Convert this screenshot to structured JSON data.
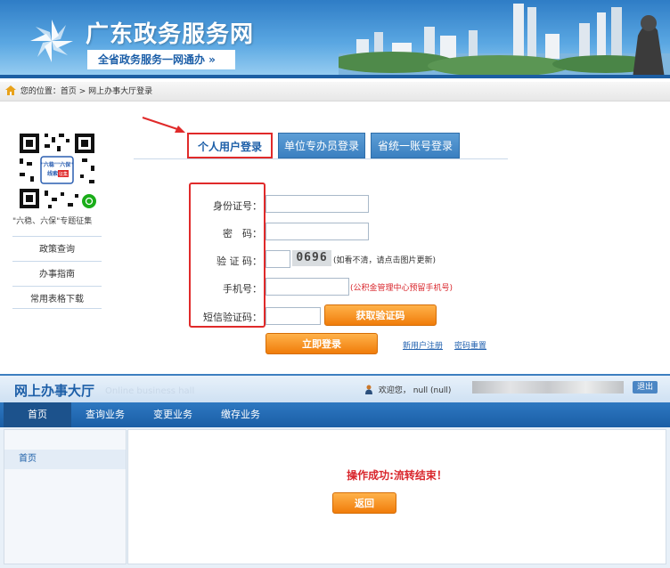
{
  "banner": {
    "site_title": "广东政务服务网",
    "slogan": "全省政务服务一网通办 »"
  },
  "breadcrumb": {
    "prefix": "您的位置：",
    "home": "首页",
    "separator": " > ",
    "current": "网上办事大厅登录"
  },
  "sidebar": {
    "qr_caption": "\"六稳、六保\"专题征集",
    "qr_badge": [
      "\"六稳\"\"六保\"",
      "线索",
      "征集"
    ],
    "links": [
      "政策查询",
      "办事指南",
      "常用表格下载"
    ]
  },
  "tabs": [
    {
      "label": "个人用户登录",
      "active": true
    },
    {
      "label": "单位专办员登录",
      "active": false
    },
    {
      "label": "省统一账号登录",
      "active": false
    }
  ],
  "form": {
    "id_label": "身份证号：",
    "password_label": "密　码：",
    "captcha_label": "验 证 码：",
    "captcha_value": "0696",
    "captcha_hint": "(如看不清，请点击图片更新)",
    "phone_label": "手机号：",
    "phone_hint": "(公积金管理中心预留手机号)",
    "sms_label": "短信验证码：",
    "get_code_button": "获取验证码",
    "login_button": "立即登录",
    "register_link": "新用户注册",
    "reset_link": "密码重置"
  },
  "hall": {
    "title": "网上办事大厅",
    "subtitle": "Online business hall",
    "welcome": "欢迎您， null (null)",
    "logout": "退出",
    "nav": [
      {
        "label": "首页",
        "active": true
      },
      {
        "label": "查询业务",
        "active": false
      },
      {
        "label": "变更业务",
        "active": false
      },
      {
        "label": "缴存业务",
        "active": false
      }
    ],
    "side_item": "首页",
    "message": "操作成功:流转结束！",
    "back_button": "返回"
  },
  "colors": {
    "brand_blue": "#1d5fa8",
    "nav_blue": "#2e78c1",
    "alert_red": "#e02a2a",
    "button_orange": "#f07c0a"
  }
}
